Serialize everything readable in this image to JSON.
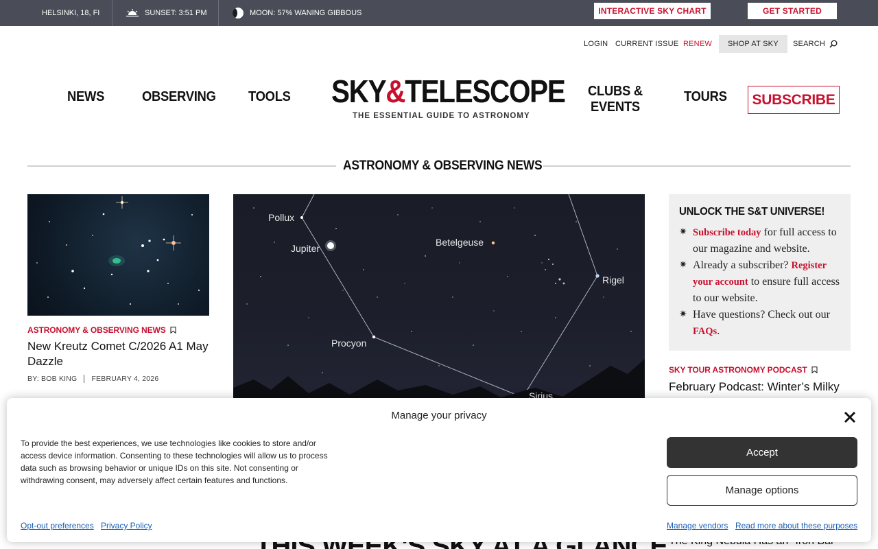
{
  "topbar": {
    "location": "HELSINKI, 18, FI",
    "sunset": "SUNSET: 3:51 PM",
    "moon": "MOON: 57% WANING GIBBOUS",
    "sky_chart_button": "INTERACTIVE SKY CHART",
    "get_started_button": "GET STARTED",
    "background": "#4a4d57",
    "button_text_color": "#c8102e"
  },
  "secondary_nav": {
    "login": "LOGIN",
    "current_issue": "CURRENT ISSUE",
    "renew": "RENEW",
    "shop": "SHOP AT SKY",
    "search": "SEARCH"
  },
  "main_nav": {
    "news": "NEWS",
    "observing": "OBSERVING",
    "tools": "TOOLS",
    "clubs_line1": "CLUBS &",
    "clubs_line2": "EVENTS",
    "tours": "TOURS",
    "subscribe": "SUBSCRIBE"
  },
  "logo": {
    "sky": "SKY",
    "amp": "&",
    "telescope": "TELESCOPE",
    "tagline": "THE ESSENTIAL GUIDE TO ASTRONOMY"
  },
  "section": {
    "title": "ASTRONOMY & OBSERVING NEWS"
  },
  "left_article": {
    "tag": "ASTRONOMY & OBSERVING NEWS",
    "title_line1": "New Kreutz Comet C/2026 A1 May",
    "title_line2": "Dazzle",
    "byline": "BY: BOB KING",
    "date": "FEBRUARY 4, 2026"
  },
  "feature_image": {
    "labels": {
      "pollux": "Pollux",
      "jupiter": "Jupiter",
      "betelgeuse": "Betelgeuse",
      "rigel": "Rigel",
      "procyon": "Procyon",
      "sirius": "Sirius"
    }
  },
  "promo": {
    "title": "UNLOCK THE S&T UNIVERSE!",
    "item1_red": "Subscribe today",
    "item1_rest": " for full access to our magazine and website.",
    "item2_start": "Already a subscriber? ",
    "item2_red": "Register your account",
    "item2_rest": " to ensure full access to our website.",
    "item3_start": "Have questions? Check out our ",
    "item3_red": "FAQs",
    "item3_end": "."
  },
  "right_article": {
    "tag": "SKY TOUR ASTRONOMY PODCAST",
    "title": "February Podcast: Winter’s Milky"
  },
  "behind_overlay": {
    "headline": "THIS WEEK'S SKY AT A GLANCE,",
    "right_title": "The King Nebula Has an \"Iron Bar\""
  },
  "cookie": {
    "title": "Manage your privacy",
    "text": "To provide the best experiences, we use technologies like cookies to store and/or access device information. Consenting to these technologies will allow us to process data such as browsing behavior or unique IDs on this site. Not consenting or withdrawing consent, may adversely affect certain features and functions.",
    "accept": "Accept",
    "manage_options": "Manage options",
    "opt_out": "Opt-out preferences",
    "privacy_policy": "Privacy Policy",
    "manage_vendors": "Manage vendors",
    "read_more": "Read more about these purposes"
  },
  "icons": {
    "sunset": "sunset-icon",
    "moon": "moon-icon",
    "search": "search-icon",
    "bookmark": "bookmark-icon",
    "close": "close-icon",
    "bullet": "star-bullet-icon"
  },
  "colors": {
    "brand_red": "#c8102e",
    "accept_bg": "#333333",
    "link": "#1a5fb4"
  }
}
